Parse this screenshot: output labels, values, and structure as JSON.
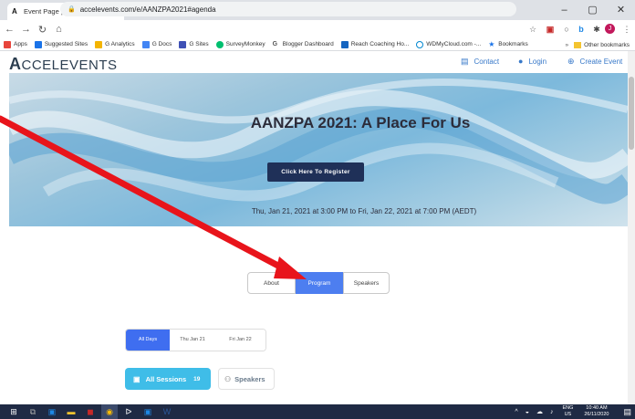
{
  "browser": {
    "tab_title": "Event Page | AANZPA 2021: A Pla",
    "url": "accelevents.com/e/AANZPA2021#agenda",
    "bookmarks": [
      {
        "label": "Apps",
        "color": "#e8453c"
      },
      {
        "label": "Suggested Sites",
        "color": "#1a73e8"
      },
      {
        "label": "G Analytics",
        "color": "#f4b400"
      },
      {
        "label": "G Docs",
        "color": "#4285f4"
      },
      {
        "label": "G Sites",
        "color": "#3f51b5"
      },
      {
        "label": "SurveyMonkey",
        "color": "#00bf6f"
      },
      {
        "label": "Blogger Dashboard",
        "color": "#f57c00"
      },
      {
        "label": "Reach Coaching Ho...",
        "color": "#1565c0"
      },
      {
        "label": "WDMyCloud.com -...",
        "color": "#0288d1"
      },
      {
        "label": "Bookmarks",
        "color": "#1a73e8"
      }
    ],
    "other_bookmarks": "Other bookmarks"
  },
  "site": {
    "logo_a": "A",
    "logo_rest": "CCELEVENTS",
    "nav": {
      "contact": "Contact",
      "login": "Login",
      "create_event": "Create Event"
    }
  },
  "hero": {
    "title": "AANZPA 2021: A Place For Us",
    "register": "Click Here To Register",
    "date": "Thu, Jan 21, 2021 at 3:00 PM to Fri, Jan 22, 2021 at 7:00 PM (AEDT)"
  },
  "tabs": {
    "about": "About",
    "program": "Program",
    "speakers": "Speakers",
    "active": "Program"
  },
  "days": {
    "all": "All Days",
    "d1": "Thu Jan 21",
    "d2": "Fri Jan 22",
    "active": "All Days"
  },
  "filters": {
    "sessions": "All Sessions",
    "sessions_count": "19",
    "speakers": "Speakers"
  },
  "taskbar": {
    "lang1": "ENG",
    "lang2": "US",
    "time": "10:40 AM",
    "date": "26/11/2020"
  },
  "colors": {
    "accent": "#4d7ef0",
    "sessions": "#3fbde8",
    "register": "#1f3058",
    "arrow": "#e8141b"
  }
}
